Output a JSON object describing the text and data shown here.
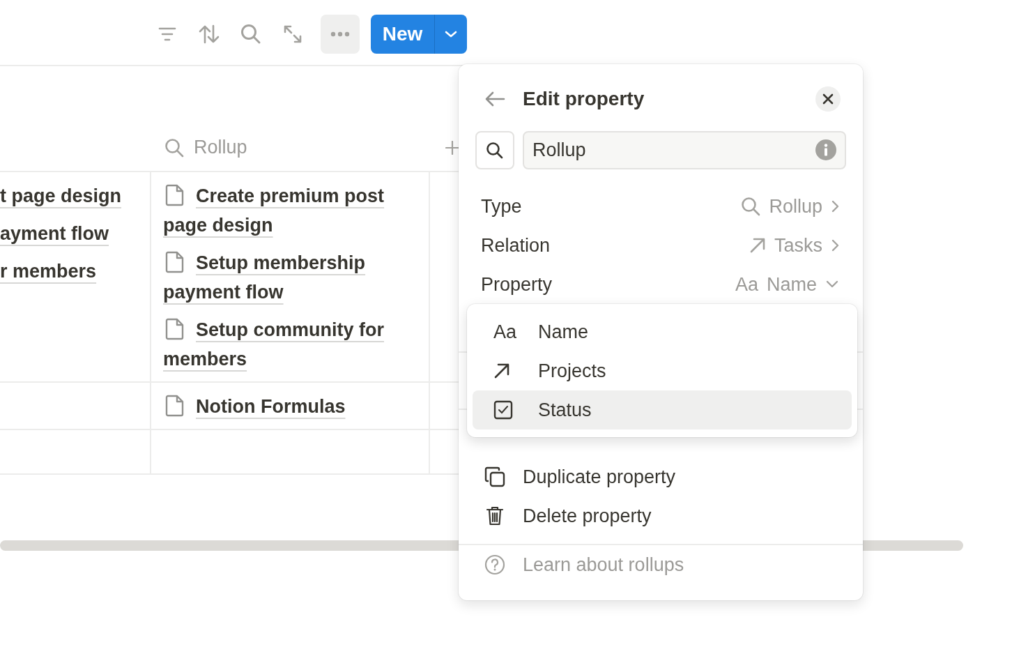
{
  "new_button": {
    "label": "New"
  },
  "table": {
    "rollup_header": "Rollup",
    "rows": [
      {
        "column_1": [
          "t page design",
          "ayment flow",
          "r members"
        ],
        "rollup": [
          "Create premium post page design",
          "Setup membership payment flow",
          "Setup community for members"
        ]
      },
      {
        "column_1": [],
        "rollup": [
          "Notion Formulas"
        ]
      }
    ]
  },
  "edit_property": {
    "title": "Edit property",
    "type_field": {
      "value": "Rollup"
    },
    "settings": [
      {
        "label": "Type",
        "value": "Rollup",
        "kind": "type"
      },
      {
        "label": "Relation",
        "value": "Tasks",
        "kind": "relation"
      },
      {
        "label": "Property",
        "value": "Name",
        "icon_text": "Aa",
        "kind": "property"
      }
    ],
    "actions": [
      {
        "label": "Duplicate property",
        "kind": "duplicate"
      },
      {
        "label": "Delete property",
        "kind": "delete"
      }
    ],
    "help_link": "Learn about rollups"
  },
  "property_dropdown": {
    "options": [
      {
        "label": "Name",
        "kind": "text",
        "icon_text": "Aa",
        "selected": false
      },
      {
        "label": "Projects",
        "kind": "relation",
        "selected": false
      },
      {
        "label": "Status",
        "kind": "checkbox",
        "selected": true
      }
    ]
  }
}
